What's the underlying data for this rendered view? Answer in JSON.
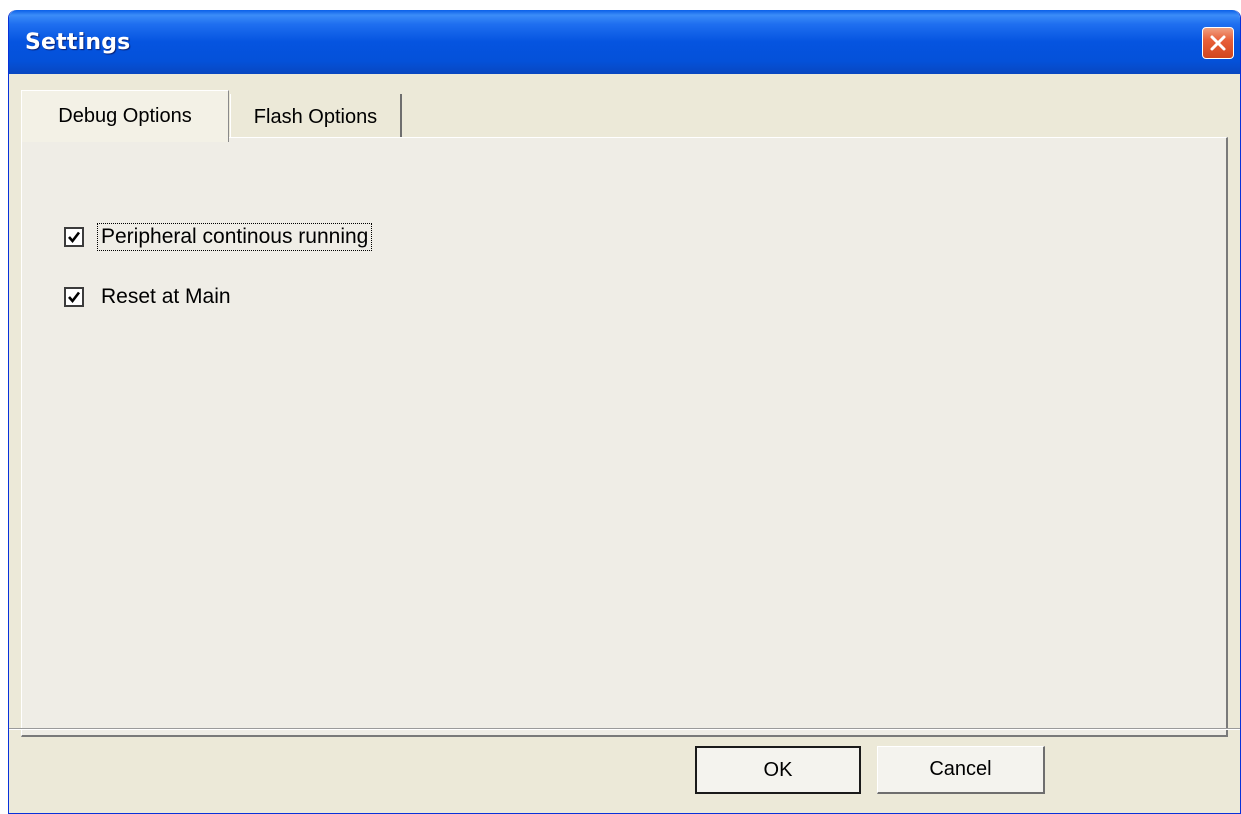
{
  "window": {
    "title": "Settings",
    "close_icon": "close-icon"
  },
  "tabs": [
    {
      "label": "Debug Options",
      "active": true
    },
    {
      "label": "Flash Options",
      "active": false
    }
  ],
  "options": [
    {
      "label": "Peripheral continous running",
      "checked": true,
      "focused": true
    },
    {
      "label": "Reset at Main",
      "checked": true,
      "focused": false
    }
  ],
  "buttons": {
    "ok_label": "OK",
    "cancel_label": "Cancel"
  },
  "colors": {
    "titlebar": "#0554e0",
    "dialog_face": "#ece9d8",
    "close_button": "#e8603a"
  }
}
